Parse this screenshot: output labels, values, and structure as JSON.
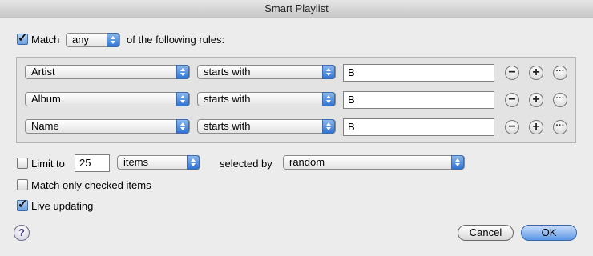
{
  "window": {
    "title": "Smart Playlist"
  },
  "match": {
    "checked": true,
    "label": "Match",
    "mode": "any",
    "suffix": "of the following rules:"
  },
  "rules": [
    {
      "field": "Artist",
      "operator": "starts with",
      "value": "B"
    },
    {
      "field": "Album",
      "operator": "starts with",
      "value": "B"
    },
    {
      "field": "Name",
      "operator": "starts with",
      "value": "B"
    }
  ],
  "rule_buttons": {
    "remove": "−",
    "add": "+",
    "more": "···"
  },
  "limit": {
    "checked": false,
    "label": "Limit to",
    "amount": "25",
    "unit": "items",
    "selected_by_label": "selected by",
    "selected_by": "random"
  },
  "match_checked": {
    "checked": false,
    "label": "Match only checked items"
  },
  "live_updating": {
    "checked": true,
    "label": "Live updating"
  },
  "buttons": {
    "help": "?",
    "cancel": "Cancel",
    "ok": "OK"
  },
  "colors": {
    "accent": "#5c97e6"
  }
}
